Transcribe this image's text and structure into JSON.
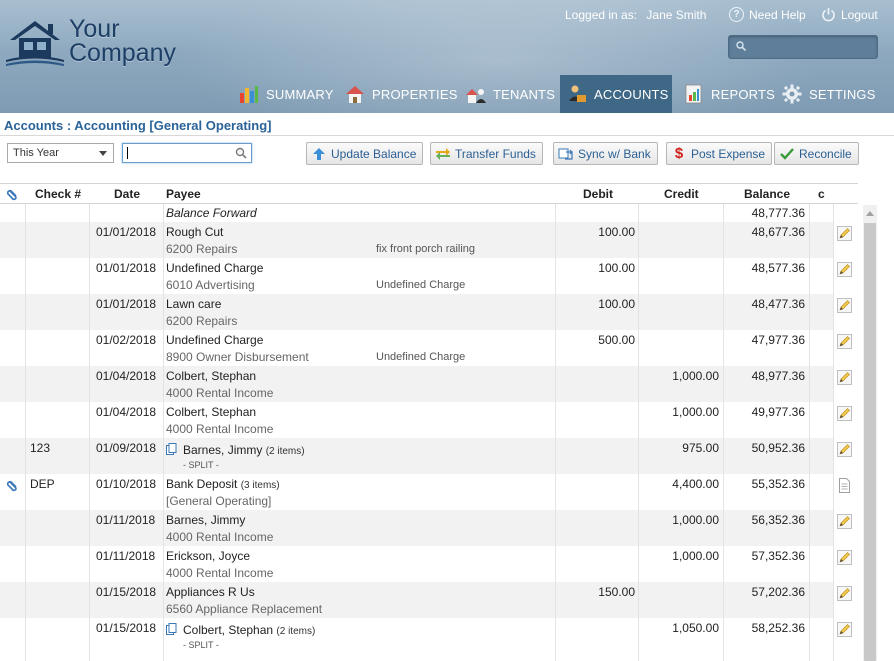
{
  "header": {
    "brand_line1": "Your",
    "brand_line2": "Company",
    "login_label": "Logged in as:",
    "login_user": "Jane Smith",
    "help_label": "Need Help",
    "logout_label": "Logout"
  },
  "nav": {
    "items": [
      {
        "label": "SUMMARY",
        "icon": "bar-chart-icon"
      },
      {
        "label": "PROPERTIES",
        "icon": "house-icon"
      },
      {
        "label": "TENANTS",
        "icon": "tenants-icon"
      },
      {
        "label": "ACCOUNTS",
        "icon": "accounts-icon",
        "active": true
      },
      {
        "label": "REPORTS",
        "icon": "reports-icon"
      },
      {
        "label": "SETTINGS",
        "icon": "gear-icon"
      }
    ]
  },
  "breadcrumb": "Accounts : Accounting [General Operating]",
  "toolbar": {
    "period_select": "This Year",
    "filter_value": "",
    "buttons": [
      {
        "label": "Update Balance",
        "icon": "upload-arrow-icon"
      },
      {
        "label": "Transfer Funds",
        "icon": "transfer-arrows-icon"
      },
      {
        "label": "Sync w/ Bank",
        "icon": "sync-icon"
      },
      {
        "label": "Post Expense",
        "icon": "dollar-icon"
      },
      {
        "label": "Reconcile",
        "icon": "checkmark-icon"
      }
    ]
  },
  "table": {
    "headers": {
      "attach": "paperclip-icon",
      "check": "Check #",
      "date": "Date",
      "payee": "Payee",
      "debit": "Debit",
      "credit": "Credit",
      "balance": "Balance",
      "c": "c"
    },
    "balance_forward": {
      "label": "Balance Forward",
      "balance": "48,777.36"
    },
    "rows": [
      {
        "check": "",
        "date": "01/01/2018",
        "payee": "Rough Cut",
        "items": "",
        "sub": "6200 Repairs",
        "memo": "fix front porch railing",
        "debit": "100.00",
        "credit": "",
        "balance": "48,677.36",
        "attach": false,
        "split": false,
        "action": "edit"
      },
      {
        "check": "",
        "date": "01/01/2018",
        "payee": "Undefined Charge",
        "items": "",
        "sub": "6010 Advertising",
        "memo": "Undefined Charge",
        "debit": "100.00",
        "credit": "",
        "balance": "48,577.36",
        "attach": false,
        "split": false,
        "action": "edit"
      },
      {
        "check": "",
        "date": "01/01/2018",
        "payee": "Lawn care",
        "items": "",
        "sub": "6200 Repairs",
        "memo": "",
        "debit": "100.00",
        "credit": "",
        "balance": "48,477.36",
        "attach": false,
        "split": false,
        "action": "edit"
      },
      {
        "check": "",
        "date": "01/02/2018",
        "payee": "Undefined Charge",
        "items": "",
        "sub": "8900 Owner Disbursement",
        "memo": "Undefined Charge",
        "debit": "500.00",
        "credit": "",
        "balance": "47,977.36",
        "attach": false,
        "split": false,
        "action": "edit"
      },
      {
        "check": "",
        "date": "01/04/2018",
        "payee": "Colbert, Stephan",
        "items": "",
        "sub": "4000 Rental Income",
        "memo": "",
        "debit": "",
        "credit": "1,000.00",
        "balance": "48,977.36",
        "attach": false,
        "split": false,
        "action": "edit"
      },
      {
        "check": "",
        "date": "01/04/2018",
        "payee": "Colbert, Stephan",
        "items": "",
        "sub": "4000 Rental Income",
        "memo": "",
        "debit": "",
        "credit": "1,000.00",
        "balance": "49,977.36",
        "attach": false,
        "split": false,
        "action": "edit"
      },
      {
        "check": "123",
        "date": "01/09/2018",
        "payee": "Barnes, Jimmy",
        "items": "(2 items)",
        "sub": "- SPLIT -",
        "memo": "",
        "debit": "",
        "credit": "975.00",
        "balance": "50,952.36",
        "attach": false,
        "split": true,
        "action": "edit"
      },
      {
        "check": "DEP",
        "date": "01/10/2018",
        "payee": "Bank Deposit",
        "items": "(3 items)",
        "sub": "[General Operating]",
        "memo": "",
        "debit": "",
        "credit": "4,400.00",
        "balance": "55,352.36",
        "attach": true,
        "split": false,
        "action": "view"
      },
      {
        "check": "",
        "date": "01/11/2018",
        "payee": "Barnes, Jimmy",
        "items": "",
        "sub": "4000 Rental Income",
        "memo": "",
        "debit": "",
        "credit": "1,000.00",
        "balance": "56,352.36",
        "attach": false,
        "split": false,
        "action": "edit"
      },
      {
        "check": "",
        "date": "01/11/2018",
        "payee": "Erickson, Joyce",
        "items": "",
        "sub": "4000 Rental Income",
        "memo": "",
        "debit": "",
        "credit": "1,000.00",
        "balance": "57,352.36",
        "attach": false,
        "split": false,
        "action": "edit"
      },
      {
        "check": "",
        "date": "01/15/2018",
        "payee": "Appliances R Us",
        "items": "",
        "sub": "6560 Appliance Replacement",
        "memo": "",
        "debit": "150.00",
        "credit": "",
        "balance": "57,202.36",
        "attach": false,
        "split": false,
        "action": "edit"
      },
      {
        "check": "",
        "date": "01/15/2018",
        "payee": "Colbert, Stephan",
        "items": "(2 items)",
        "sub": "- SPLIT -",
        "memo": "",
        "debit": "",
        "credit": "1,050.00",
        "balance": "58,252.36",
        "attach": false,
        "split": true,
        "action": "edit"
      }
    ]
  },
  "colors": {
    "header_top": "#a9bfd0",
    "nav_active": "#3f6786",
    "link_blue": "#2b6398",
    "row_alt": "#f2f2f2"
  }
}
